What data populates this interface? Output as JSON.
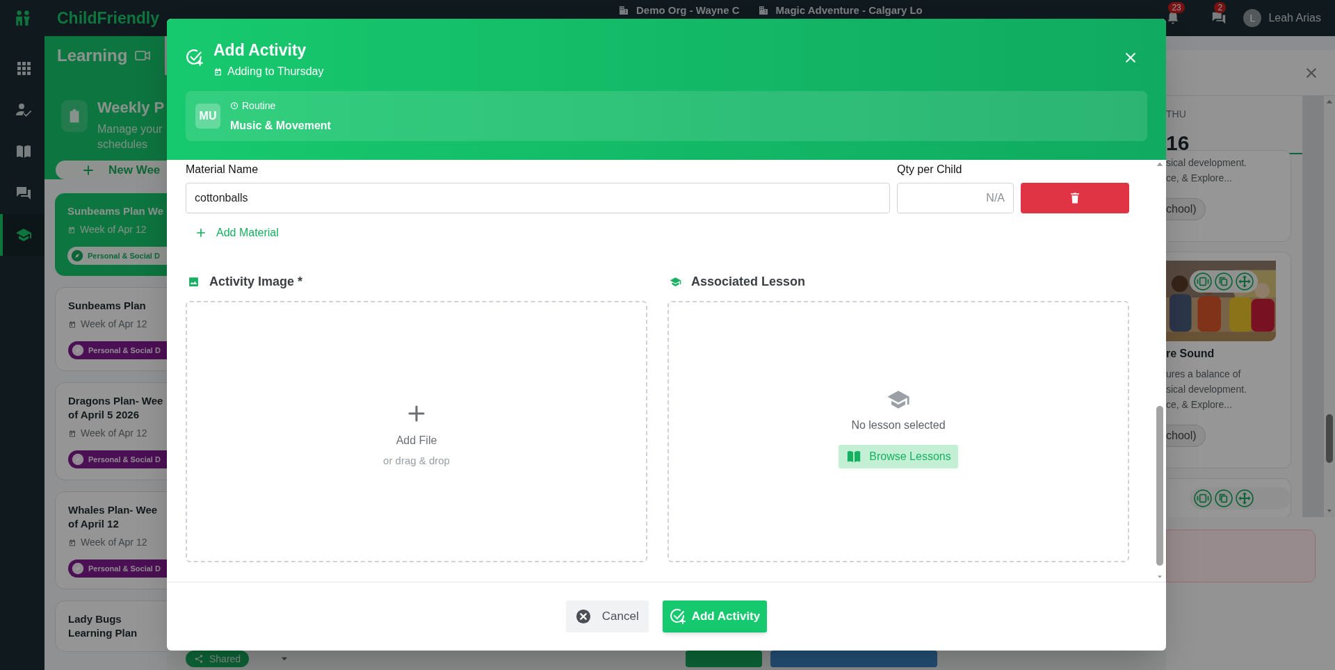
{
  "top_bar": {
    "logo": "ChildFriendly",
    "org": "Demo Org - Wayne C",
    "location": "Magic Adventure - Calgary Lo",
    "notifications_count": "23",
    "messages_count": "2",
    "avatar_initial": "L",
    "user_name": "Leah Arias"
  },
  "rail": [
    {
      "kind": "apps",
      "selected": false
    },
    {
      "kind": "attendance",
      "selected": false
    },
    {
      "kind": "library",
      "selected": false
    },
    {
      "kind": "messages",
      "selected": false
    },
    {
      "kind": "learning",
      "selected": true
    }
  ],
  "learning": {
    "title": "Learning",
    "heading": "Weekly P",
    "subtitle": "Manage your\nschedules",
    "new_button": "New Wee",
    "plans": [
      {
        "title": "Sunbeams Plan We",
        "week": "Week of Apr 12",
        "tag": "Personal & Social D",
        "selected": true
      },
      {
        "title": "Sunbeams Plan",
        "week": "Week of Apr 12",
        "tag": "Personal & Social D",
        "selected": false
      },
      {
        "title": "Dragons Plan- Wee\nof April 5 2026",
        "week": "Week of Apr 12",
        "tag": "Personal & Social D",
        "selected": false
      },
      {
        "title": "Whales Plan- Wee\nof April 12",
        "week": "Week of Apr 12",
        "tag": "Personal & Social D",
        "selected": false
      },
      {
        "title": "Lady Bugs\nLearning Plan",
        "selected": false
      }
    ],
    "shared_button": "Shared"
  },
  "week_panel": {
    "day": "THU",
    "date": "16",
    "cards": [
      {
        "kind": "text",
        "lines": [
          "sical development.",
          "ce, & Explore..."
        ],
        "tag": "chool)"
      },
      {
        "title": "re Sound",
        "lines": [
          "ures a balance of",
          "sical development.",
          "ce, & Explore..."
        ],
        "tag": "chool)"
      },
      {
        "kind": "actions"
      }
    ]
  },
  "modal": {
    "title": "Add Activity",
    "subtitle": "Adding to Thursday",
    "routine": {
      "initials": "MU",
      "category": "Routine",
      "name": "Music & Movement"
    },
    "materials": {
      "name_label": "Material Name",
      "qty_label": "Qty per Child",
      "rows": [
        {
          "name": "cottonballs",
          "qty_placeholder": "N/A"
        }
      ],
      "add_button": "Add Material"
    },
    "image_section": {
      "title": "Activity Image *",
      "add_label": "Add File",
      "hint": "or drag & drop"
    },
    "lesson_section": {
      "title": "Associated Lesson",
      "empty": "No lesson selected",
      "browse_button": "Browse Lessons"
    },
    "buttons": [
      {
        "label": "Cancel",
        "kind": "secondary"
      },
      {
        "label": "Add Activity",
        "kind": "primary"
      }
    ]
  }
}
